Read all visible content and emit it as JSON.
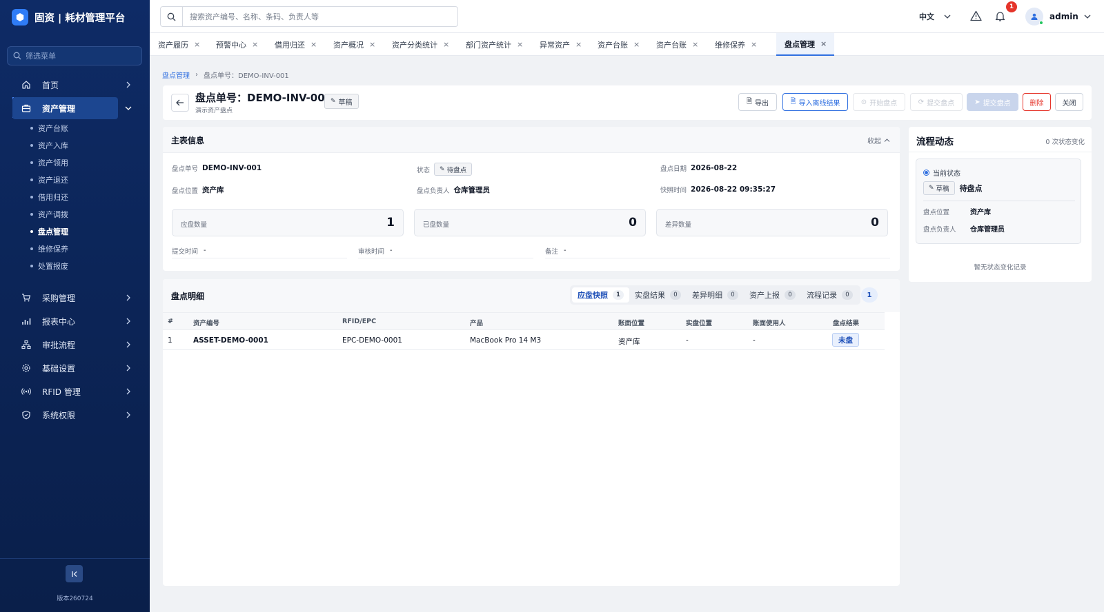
{
  "app": {
    "logo_icon": "hexagon-icon",
    "title": "固资 | 耗材管理平台",
    "version": "版本260724"
  },
  "sidebar": {
    "search_placeholder": "筛选菜单",
    "items": [
      {
        "label": "首页",
        "icon": "home-icon"
      },
      {
        "label": "资产管理",
        "icon": "briefcase-icon",
        "active": true
      },
      {
        "label": "采购管理",
        "icon": "cart-icon"
      },
      {
        "label": "报表中心",
        "icon": "bar-chart-icon"
      },
      {
        "label": "审批流程",
        "icon": "workflow-icon"
      },
      {
        "label": "基础设置",
        "icon": "gear-icon"
      },
      {
        "label": "RFID 管理",
        "icon": "rfid-icon"
      },
      {
        "label": "系统权限",
        "icon": "shield-icon"
      }
    ],
    "sub_items": [
      "资产台账",
      "资产入库",
      "资产领用",
      "资产退还",
      "借用归还",
      "资产调拨",
      "盘点管理",
      "维修保养",
      "处置报废"
    ],
    "active_sub": "盘点管理"
  },
  "topbar": {
    "search_placeholder": "搜索资产编号、名称、条码、负责人等",
    "language": "中文",
    "notification_count": "1",
    "username": "admin"
  },
  "tabs": [
    {
      "label": "资产履历"
    },
    {
      "label": "预警中心"
    },
    {
      "label": "借用归还"
    },
    {
      "label": "资产概况"
    },
    {
      "label": "资产分类统计"
    },
    {
      "label": "部门资产统计"
    },
    {
      "label": "异常资产"
    },
    {
      "label": "资产台账"
    },
    {
      "label": "资产台账"
    },
    {
      "label": "维修保养"
    },
    {
      "label": "盘点管理",
      "active": true
    }
  ],
  "breadcrumb": {
    "root": "盘点管理",
    "current": "盘点单号：DEMO-INV-001"
  },
  "header": {
    "title": "盘点单号：DEMO-INV-001",
    "subtitle": "演示资产盘点",
    "status_tag": "草稿",
    "buttons": {
      "export": "导出",
      "import_offline": "导入离线结果",
      "start": "开始盘点",
      "submit_check": "提交盘点",
      "submit": "提交盘点",
      "delete": "删除",
      "close": "关闭"
    }
  },
  "main_info": {
    "title": "主表信息",
    "collapse_label": "收起",
    "fields": {
      "order_no": {
        "label": "盘点单号",
        "value": "DEMO-INV-001"
      },
      "status": {
        "label": "状态",
        "value": "待盘点"
      },
      "date": {
        "label": "盘点日期",
        "value": "2026-08-22"
      },
      "location": {
        "label": "盘点位置",
        "value": "资产库"
      },
      "owner": {
        "label": "盘点负责人",
        "value": "仓库管理员"
      },
      "snapshot_time": {
        "label": "快照时间",
        "value": "2026-08-22 09:35:27"
      }
    },
    "stats": [
      {
        "label": "应盘数量",
        "value": "1"
      },
      {
        "label": "已盘数量",
        "value": "0"
      },
      {
        "label": "差异数量",
        "value": "0"
      }
    ],
    "lines": [
      {
        "label": "提交时间",
        "value": "-"
      },
      {
        "label": "审核时间",
        "value": "-"
      },
      {
        "label": "备注",
        "value": "-"
      }
    ]
  },
  "flow": {
    "title": "流程动态",
    "change_count": "0 次状态变化",
    "current_label": "当前状态",
    "from_status": "草稿",
    "to_status": "待盘点",
    "location_label": "盘点位置",
    "location_value": "资产库",
    "owner_label": "盘点负责人",
    "owner_value": "仓库管理员",
    "empty_text": "暂无状态变化记录"
  },
  "detail": {
    "title": "盘点明细",
    "tabs": [
      {
        "label": "应盘快照",
        "count": "1",
        "active": true
      },
      {
        "label": "实盘结果",
        "count": "0"
      },
      {
        "label": "差异明细",
        "count": "0"
      },
      {
        "label": "资产上报",
        "count": "0"
      },
      {
        "label": "流程记录",
        "count": "0"
      }
    ],
    "total": "1",
    "columns": [
      "#",
      "资产编号",
      "RFID/EPC",
      "产品",
      "账面位置",
      "实盘位置",
      "账面使用人",
      "盘点结果"
    ],
    "rows": [
      {
        "index": "1",
        "asset_no": "ASSET-DEMO-0001",
        "epc": "EPC-DEMO-0001",
        "product": "MacBook Pro 14 M3",
        "book_location": "资产库",
        "actual_location": "-",
        "book_user": "-",
        "result": "未盘"
      }
    ]
  }
}
